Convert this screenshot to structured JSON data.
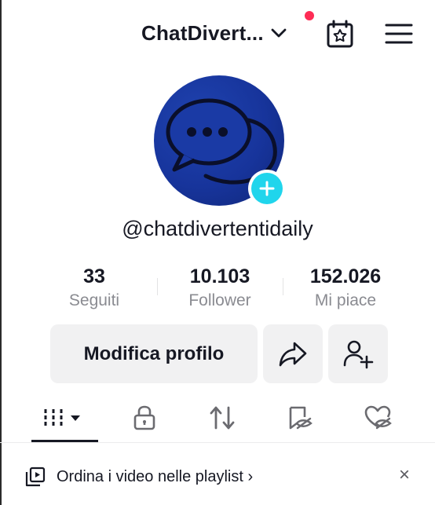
{
  "header": {
    "account_name": "ChatDivert...",
    "notification_dot_color": "#fe2c55",
    "icons": [
      "chevron-down-icon",
      "calendar-star-icon",
      "hamburger-menu-icon"
    ]
  },
  "profile": {
    "handle": "@chatdivertentidaily",
    "avatar_color": "#17349b",
    "add_badge_color": "#20d5ec"
  },
  "stats": [
    {
      "value": "33",
      "label": "Seguiti"
    },
    {
      "value": "10.103",
      "label": "Follower"
    },
    {
      "value": "152.026",
      "label": "Mi piace"
    }
  ],
  "actions": {
    "edit_label": "Modifica profilo",
    "share_icon": "share-arrow-icon",
    "add_friend_icon": "add-friend-icon"
  },
  "tabs": [
    {
      "name": "videos",
      "icon": "grid-icon",
      "active": true
    },
    {
      "name": "private",
      "icon": "lock-icon"
    },
    {
      "name": "reposts",
      "icon": "repost-icon"
    },
    {
      "name": "favorites",
      "icon": "bookmark-hidden-icon"
    },
    {
      "name": "liked",
      "icon": "heart-hidden-icon"
    }
  ],
  "banner": {
    "text": "Ordina i video nelle playlist ›",
    "close": "×"
  }
}
